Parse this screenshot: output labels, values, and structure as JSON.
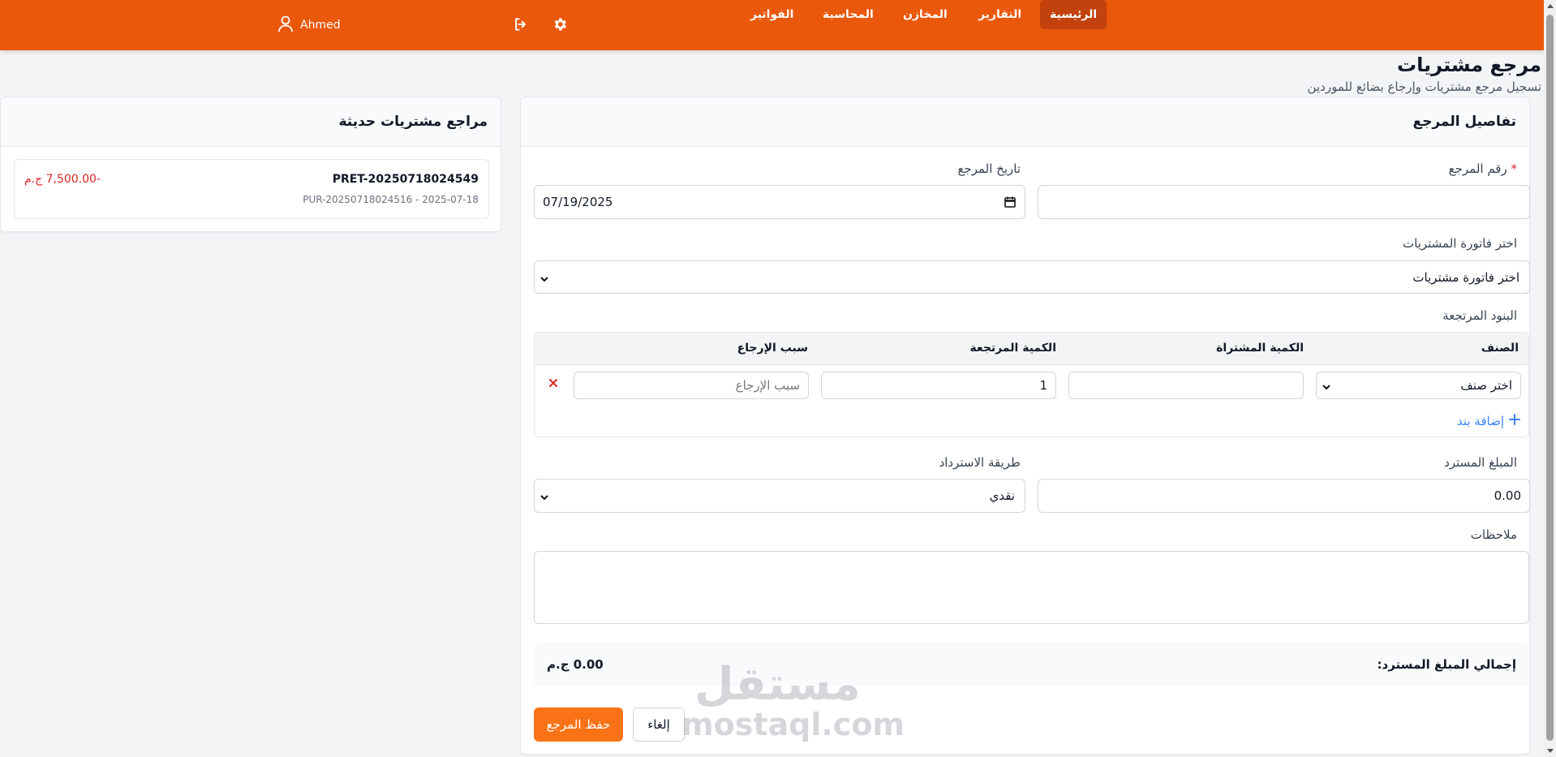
{
  "nav": {
    "items": [
      "الرئيسية",
      "التقارير",
      "المخازن",
      "المحاسبة",
      "الفواتير"
    ],
    "active": "الرئيسية",
    "user_name": "Ahmed"
  },
  "page": {
    "title": "مرجع مشتريات",
    "subtitle": "تسجيل مرجع مشتريات وإرجاع بضائع للموردين"
  },
  "recent": {
    "title": "مراجع مشتريات حديثة",
    "items": [
      {
        "number": "PRET-20250718024549",
        "meta": "PUR-20250718024516 - 2025-07-18",
        "amount": "-7,500.00 ج.م"
      }
    ]
  },
  "form": {
    "title": "تفاصيل المرجع",
    "return_no_label": "رقم المرجع",
    "required_mark": "*",
    "return_no_value": "",
    "date_label": "تاريخ المرجع",
    "date_value": "07/19/2025",
    "invoice_label": "اختر فاتورة المشتريات",
    "invoice_selected": "اختر فاتورة مشتريات",
    "items_label": "البنود المرتجعة",
    "columns": [
      "الصنف",
      "الكمية المشتراة",
      "الكمية المرتجعة",
      "سبب الإرجاع"
    ],
    "row": {
      "item_selected": "اختر صنف",
      "purchased_qty": "",
      "returned_qty": "1",
      "reason_placeholder": "سبب الإرجاع"
    },
    "add_line": "إضافة بند",
    "refund_amount_label": "المبلغ المسترد",
    "refund_amount_value": "0.00",
    "refund_method_label": "طريقة الاسترداد",
    "refund_method_selected": "نقدي",
    "notes_label": "ملاحظات",
    "total_label": "إجمالي المبلغ المسترد:",
    "total_value": "0.00 ج.م",
    "save_label": "حفظ المرجع",
    "cancel_label": "إلغاء"
  },
  "watermark": {
    "ar": "مستقل",
    "en": "mostaql.com"
  },
  "colors": {
    "brand": "#ea580c",
    "accent": "#f97316",
    "danger": "#dc2626",
    "link": "#3b82f6"
  }
}
